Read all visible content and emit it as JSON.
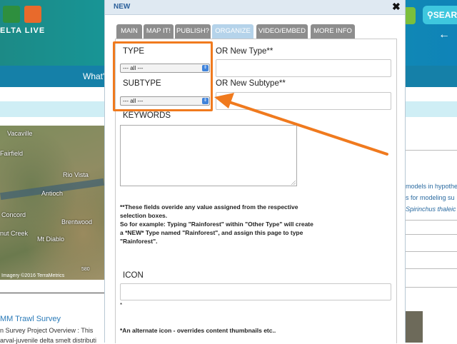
{
  "background": {
    "brand": "ELTA LIVE",
    "search_label": "SEAR",
    "back_arrow": "←",
    "nav_text": "What'",
    "map": {
      "labels": [
        "Vacaville",
        "Fairfield",
        "Rio Vista",
        "Antioch",
        "Concord",
        "Brentwood",
        "nut Creek",
        "Mt Diablo"
      ],
      "credit": "Imagery ©2016 TerraMetrics",
      "road_marker": "580"
    },
    "right_snippets": [
      "models in hypothe",
      "s for modeling su",
      "Spirinchus thaleic"
    ],
    "article": {
      "title": "MM Trawl Survey",
      "lines": [
        "n Survey Project Overview : This",
        "arval-juvenile delta smelt distributi"
      ]
    }
  },
  "modal": {
    "title": "NEW",
    "close_label": "✖",
    "tabs": [
      {
        "label": "MAIN",
        "active": false
      },
      {
        "label": "MAP IT!",
        "active": false
      },
      {
        "label": "PUBLISH?",
        "active": false
      },
      {
        "label": "ORGANIZE",
        "active": true
      },
      {
        "label": "VIDEO/EMBED",
        "active": false
      },
      {
        "label": "MORE INFO",
        "active": false
      }
    ],
    "form": {
      "type_label": "TYPE",
      "type_value": "--- all ---",
      "new_type_label": "OR New Type**",
      "subtype_label": "SUBTYPE",
      "subtype_value": "--- all ---",
      "new_subtype_label": "OR New Subtype**",
      "keywords_label": "KEYWORDS",
      "note_lines": [
        "**These fields overide any value assigned from the respective",
        "selection boxes.",
        "So for example: Typing \"Rainforest\" within \"Other Type\" will create",
        "a *NEW* Type named \"Rainforest\", and assign this page to type",
        "\"Rainforest\"."
      ],
      "icon_label": "ICON",
      "icon_asterisk": "*",
      "icon_note": "*An alternate icon - overrides content thumbnails etc.."
    }
  },
  "annotation": {
    "color": "#f07a1e"
  }
}
